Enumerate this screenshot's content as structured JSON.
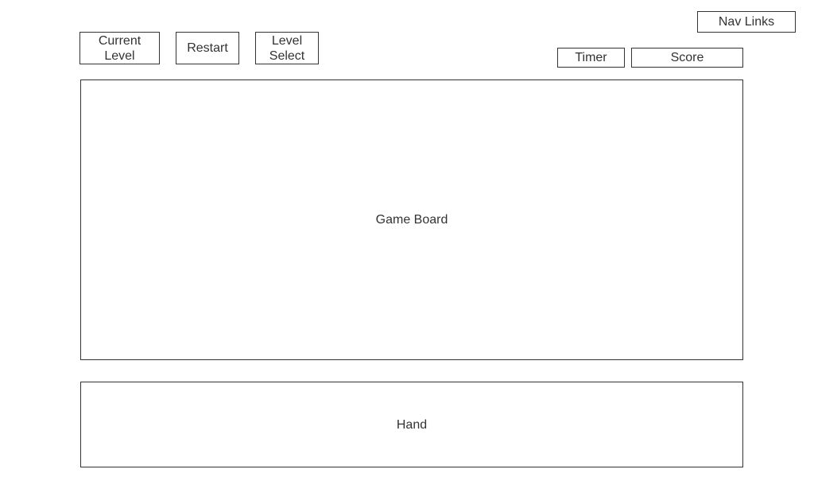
{
  "nav": {
    "label": "Nav Links"
  },
  "toolbar": {
    "current_level": "Current\nLevel",
    "restart": "Restart",
    "level_select": "Level\nSelect"
  },
  "status": {
    "timer": "Timer",
    "score": "Score"
  },
  "board": {
    "label": "Game Board"
  },
  "hand": {
    "label": "Hand"
  }
}
